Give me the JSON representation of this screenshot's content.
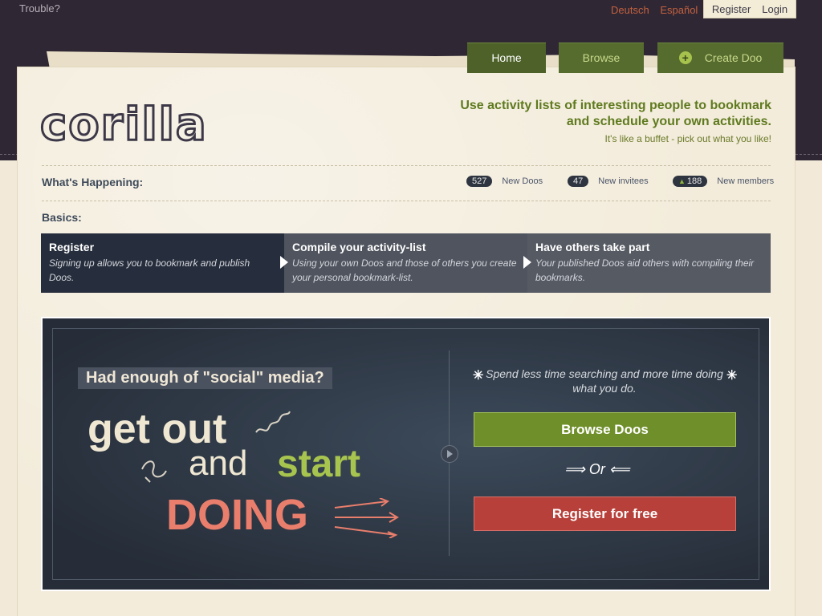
{
  "header": {
    "trouble": "Trouble?",
    "languages": [
      "Deutsch",
      "Español"
    ],
    "register": "Register",
    "login": "Login"
  },
  "nav": {
    "home": "Home",
    "browse": "Browse",
    "create": "Create Doo"
  },
  "brand": {
    "logo": "corilla",
    "tagline_line1": "Use activity lists of interesting people to bookmark",
    "tagline_line2": "and schedule your own activities.",
    "subtagline": "It's like a buffet - pick out what you like!"
  },
  "happening": {
    "label": "What's Happening:",
    "stats": [
      {
        "count": "527",
        "label": "New Doos"
      },
      {
        "count": "47",
        "label": "New invitees"
      },
      {
        "count": "188",
        "label": "New members"
      }
    ]
  },
  "basics": {
    "label": "Basics:",
    "steps": [
      {
        "title": "Register",
        "desc": "Signing up allows you to bookmark and publish Doos."
      },
      {
        "title": "Compile your activity-list",
        "desc": "Using your own Doos and those of others you create your personal bookmark-list."
      },
      {
        "title": "Have others take part",
        "desc": "Your published Doos aid others with compiling their bookmarks."
      }
    ]
  },
  "promo": {
    "headline": "Had enough of \"social\" media?",
    "line1": "get out",
    "line2": "and",
    "line3": "start",
    "line4": "DOING",
    "right_text": "Spend less time searching and more time doing what you do.",
    "browse_button": "Browse Doos",
    "or": "Or",
    "register_button": "Register for free"
  },
  "colors": {
    "top_band": "#2f2834",
    "paper": "#f3ecdb",
    "nav_green": "#566b2e",
    "accent_green": "#6f8f2a",
    "register_red": "#b8403a",
    "lang_link": "#c4603f",
    "doing_salmon": "#e97e6c"
  }
}
